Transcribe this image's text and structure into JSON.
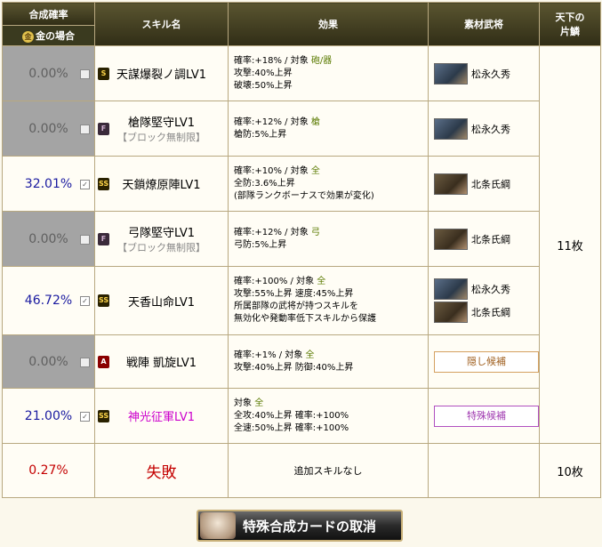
{
  "header": {
    "prob": "合成確率",
    "gold_case": "金の場合",
    "coin": "金",
    "skill": "スキル名",
    "effect": "効果",
    "material": "素材武将",
    "frag1": "天下の",
    "frag2": "片鱗"
  },
  "rows": [
    {
      "prob": "0.00%",
      "checked": false,
      "rank": "S",
      "name": "天謀爆裂ノ調LV1",
      "note": "",
      "effects": [
        "確率:+18% / 対象 ",
        "攻撃:40%上昇",
        "破壊:50%上昇"
      ],
      "target": "砲/器",
      "generals": [
        "松永久秀"
      ],
      "button": ""
    },
    {
      "prob": "0.00%",
      "checked": false,
      "rank": "F",
      "name": "槍隊堅守LV1",
      "note": "【ブロック無制限】",
      "effects": [
        "確率:+12% / 対象 ",
        "槍防:5%上昇"
      ],
      "target": "槍",
      "generals": [
        "松永久秀"
      ],
      "button": ""
    },
    {
      "prob": "32.01%",
      "checked": true,
      "rank": "SS",
      "name": "天鎖燎原陣LV1",
      "note": "",
      "effects": [
        "確率:+10% / 対象 ",
        "全防:3.6%上昇",
        "(部隊ランクボーナスで効果が変化)"
      ],
      "target": "全",
      "generals": [
        "北条氏綱"
      ],
      "button": ""
    },
    {
      "prob": "0.00%",
      "checked": false,
      "rank": "F",
      "name": "弓隊堅守LV1",
      "note": "【ブロック無制限】",
      "effects": [
        "確率:+12% / 対象 ",
        "弓防:5%上昇"
      ],
      "target": "弓",
      "generals": [
        "北条氏綱"
      ],
      "button": ""
    },
    {
      "prob": "46.72%",
      "checked": true,
      "rank": "SS",
      "name": "天香山命LV1",
      "note": "",
      "effects": [
        "確率:+100% / 対象 ",
        "攻撃:55%上昇 速度:45%上昇",
        "所属部隊の武将が持つスキルを",
        "無効化や発動率低下スキルから保護"
      ],
      "target": "全",
      "generals": [
        "松永久秀",
        "北条氏綱"
      ],
      "button": ""
    },
    {
      "prob": "0.00%",
      "checked": false,
      "rank": "A",
      "name": "戦陣 凱旋LV1",
      "note": "",
      "effects": [
        "確率:+1% / 対象 ",
        "攻撃:40%上昇 防御:40%上昇"
      ],
      "target": "全",
      "generals": [],
      "button": "隠し候補"
    },
    {
      "prob": "21.00%",
      "checked": true,
      "rank": "SS",
      "name": "神光征軍LV1",
      "note": "",
      "effects": [
        "対象 ",
        "全攻:40%上昇 確率:+100%",
        "全速:50%上昇 確率:+100%"
      ],
      "target": "全",
      "generals": [],
      "button": "特殊候補"
    }
  ],
  "fragments_main": "11枚",
  "fail_row": {
    "prob": "0.27%",
    "label": "失敗",
    "effect": "追加スキルなし",
    "fragments": "10枚"
  },
  "bottom_button": "特殊合成カードの取消",
  "checkmark": "✓"
}
